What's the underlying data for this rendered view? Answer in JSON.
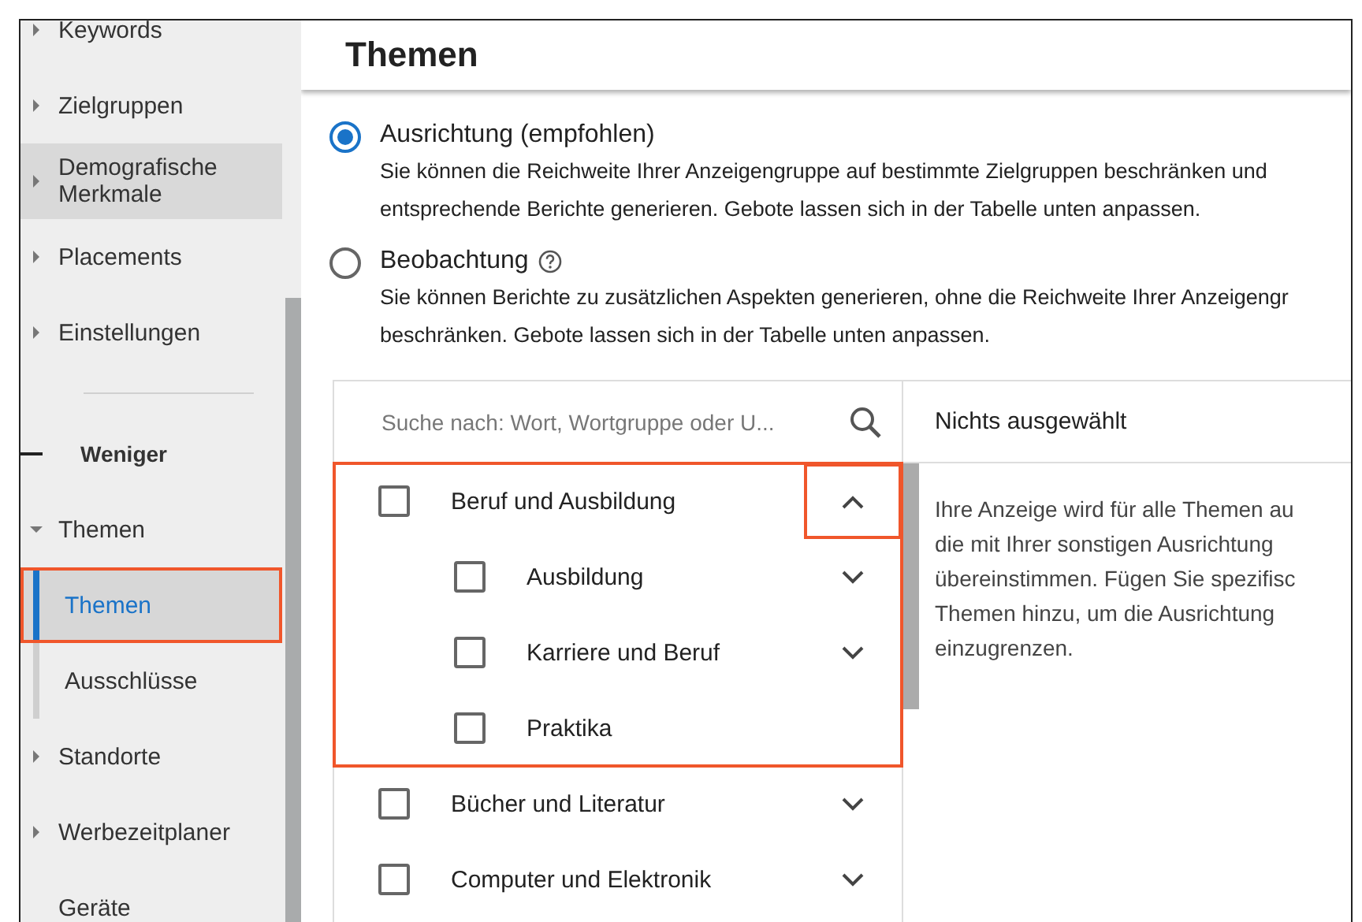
{
  "sidebar": {
    "items": [
      {
        "label": "Keywords",
        "kind": "collapsed",
        "hovered": false,
        "selected": false,
        "annotated": false
      },
      {
        "label": "Zielgruppen",
        "kind": "collapsed",
        "hovered": false,
        "selected": false,
        "annotated": false
      },
      {
        "label": "Demografische Merkmale",
        "kind": "collapsed",
        "hovered": true,
        "selected": false,
        "annotated": false
      },
      {
        "label": "Placements",
        "kind": "collapsed",
        "hovered": false,
        "selected": false,
        "annotated": false
      },
      {
        "label": "Einstellungen",
        "kind": "collapsed",
        "hovered": false,
        "selected": false,
        "annotated": false
      },
      {
        "kind": "divider"
      },
      {
        "label": "Weniger",
        "kind": "toggle"
      },
      {
        "label": "Themen",
        "kind": "expanded",
        "hovered": false,
        "selected": false,
        "annotated": false
      },
      {
        "label": "Themen",
        "kind": "child",
        "hovered": false,
        "selected": true,
        "annotated": true
      },
      {
        "label": "Ausschlüsse",
        "kind": "child",
        "hovered": false,
        "selected": false,
        "annotated": false
      },
      {
        "label": "Standorte",
        "kind": "collapsed",
        "hovered": false,
        "selected": false,
        "annotated": false
      },
      {
        "label": "Werbezeitplaner",
        "kind": "collapsed",
        "hovered": false,
        "selected": false,
        "annotated": false
      },
      {
        "label": "Geräte",
        "kind": "plain",
        "hovered": false,
        "selected": false,
        "annotated": false
      }
    ]
  },
  "page": {
    "title": "Themen"
  },
  "options": [
    {
      "label": "Ausrichtung (empfohlen)",
      "help": false,
      "selected": true,
      "lines": [
        "Sie können die Reichweite Ihrer Anzeigengruppe auf bestimmte Zielgruppen beschränken und",
        "entsprechende Berichte generieren. Gebote lassen sich in der Tabelle unten anpassen."
      ]
    },
    {
      "label": "Beobachtung",
      "help": true,
      "selected": false,
      "lines": [
        "Sie können Berichte zu zusätzlichen Aspekten generieren, ohne die Reichweite Ihrer Anzeigengr",
        "beschränken. Gebote lassen sich in der Tabelle unten anpassen."
      ]
    }
  ],
  "picker": {
    "search": {
      "placeholder": "Suche nach: Wort, Wortgruppe oder U..."
    },
    "categories": [
      {
        "label": "Beruf und Ausbildung",
        "checked": false,
        "expanded": true,
        "annotated": true,
        "children": [
          {
            "label": "Ausbildung",
            "checked": false,
            "expandable": true
          },
          {
            "label": "Karriere und Beruf",
            "checked": false,
            "expandable": true
          },
          {
            "label": "Praktika",
            "checked": false,
            "expandable": false
          }
        ]
      },
      {
        "label": "Bücher und Literatur",
        "checked": false,
        "expanded": false,
        "annotated": false
      },
      {
        "label": "Computer und Elektronik",
        "checked": false,
        "expanded": false,
        "annotated": false
      }
    ],
    "selection_title": "Nichts ausgewählt",
    "info_lines": [
      "Ihre Anzeige wird für alle Themen au",
      "die mit Ihrer sonstigen Ausrichtung",
      "übereinstimmen. Fügen Sie spezifisc",
      "Themen hinzu, um die Ausrichtung",
      "einzugrenzen."
    ]
  }
}
